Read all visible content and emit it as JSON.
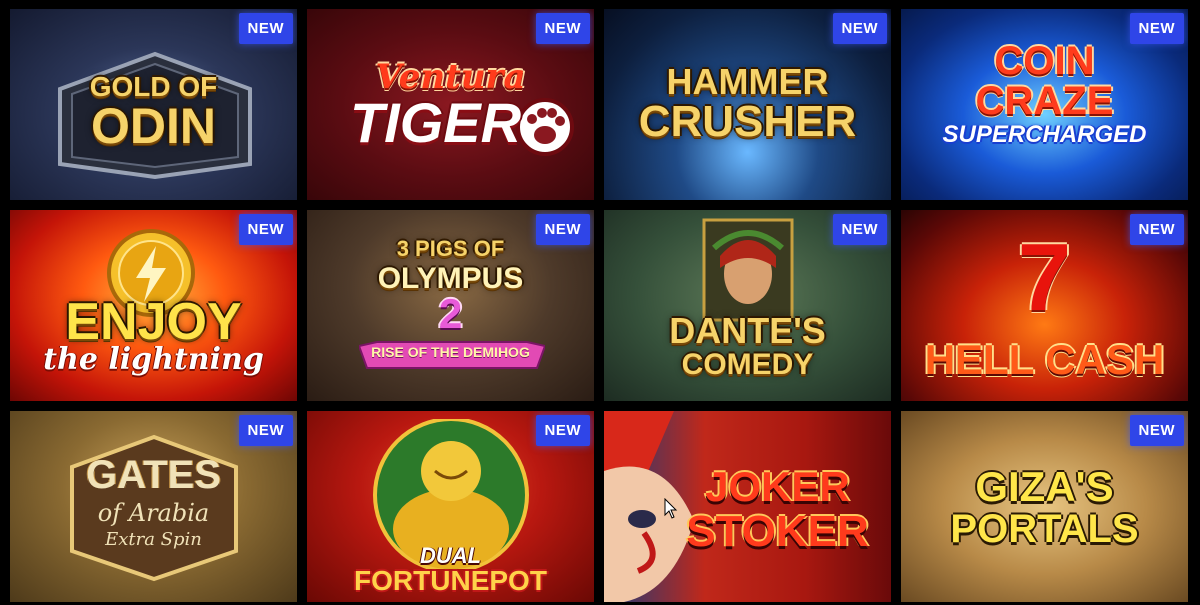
{
  "badge_label": "NEW",
  "games": [
    {
      "title_line1": "GOLD OF",
      "title_line2": "ODIN",
      "badge": "NEW"
    },
    {
      "title_line1": "Ventura",
      "title_line2": "TIGER",
      "badge": "NEW"
    },
    {
      "title_line1": "HAMMER",
      "title_line2": "CRUSHER",
      "badge": "NEW"
    },
    {
      "title_line1": "COIN",
      "title_line2": "CRAZE",
      "title_line3": "SUPERCHARGED",
      "badge": "NEW"
    },
    {
      "title_line1": "ENJOY",
      "title_line2": "the lightning",
      "badge": "NEW"
    },
    {
      "title_line1": "3 PIGS OF",
      "title_line2": "OLYMPUS",
      "title_line3": "2",
      "title_line4": "RISE OF THE DEMIHOG",
      "badge": "NEW"
    },
    {
      "title_line1": "DANTE'S",
      "title_line2": "COMEDY",
      "badge": "NEW"
    },
    {
      "title_line1": "7",
      "title_line2": "HELL CASH",
      "badge": "NEW"
    },
    {
      "title_line1": "GATES",
      "title_line2": "of Arabia",
      "title_line3": "Extra Spin",
      "badge": "NEW"
    },
    {
      "title_line1": "DUAL",
      "title_line2": "FORTUNEPOT",
      "badge": "NEW"
    },
    {
      "title_line1": "JOKER",
      "title_line2": "STOKER",
      "badge": null
    },
    {
      "title_line1": "GIZA'S",
      "title_line2": "PORTALS",
      "badge": "NEW"
    }
  ],
  "colors": {
    "badge_bg": "#2f45e8",
    "page_bg": "#000000"
  }
}
